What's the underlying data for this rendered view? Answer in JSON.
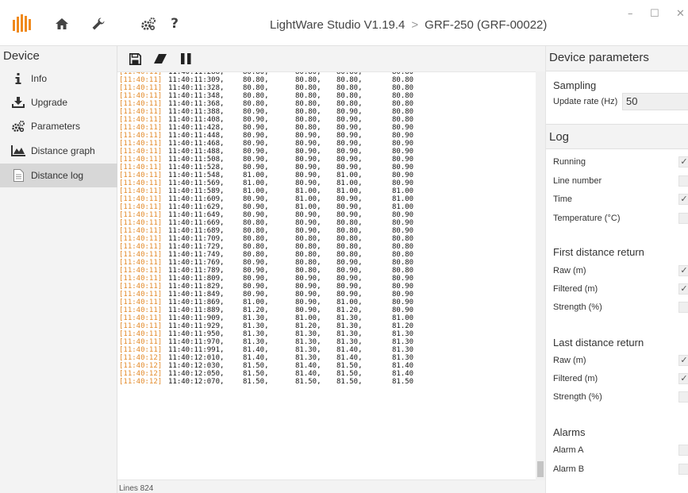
{
  "app": {
    "title": "LightWare Studio V1.19.4",
    "separator": ">",
    "device": "GRF-250 (GRF-00022)",
    "brand_color": "#f08a1d",
    "icons": [
      "home-icon",
      "wrench-icon",
      "gears-icon",
      "help-icon"
    ],
    "help_label": "?",
    "window_controls": {
      "minimize": "–",
      "maximize": "☐",
      "close": "✕"
    }
  },
  "sidebar": {
    "title": "Device",
    "items": [
      {
        "label": "Info",
        "icon": "info-icon"
      },
      {
        "label": "Upgrade",
        "icon": "download-icon"
      },
      {
        "label": "Parameters",
        "icon": "gears-icon"
      },
      {
        "label": "Distance graph",
        "icon": "area-chart-icon"
      },
      {
        "label": "Distance log",
        "icon": "document-icon",
        "active": true
      }
    ]
  },
  "log": {
    "toolbar": [
      "save-icon",
      "eraser-icon",
      "pause-icon"
    ],
    "lines_label": "Lines 824",
    "rows": [
      [
        "[11:40:11]",
        "11:40:11:288,",
        "80.80,",
        "80.80,",
        "80.80,",
        "80.80"
      ],
      [
        "[11:40:11]",
        "11:40:11:309,",
        "80.80,",
        "80.80,",
        "80.80,",
        "80.80"
      ],
      [
        "[11:40:11]",
        "11:40:11:328,",
        "80.80,",
        "80.80,",
        "80.80,",
        "80.80"
      ],
      [
        "[11:40:11]",
        "11:40:11:348,",
        "80.80,",
        "80.80,",
        "80.80,",
        "80.80"
      ],
      [
        "[11:40:11]",
        "11:40:11:368,",
        "80.80,",
        "80.80,",
        "80.80,",
        "80.80"
      ],
      [
        "[11:40:11]",
        "11:40:11:388,",
        "80.90,",
        "80.80,",
        "80.90,",
        "80.80"
      ],
      [
        "[11:40:11]",
        "11:40:11:408,",
        "80.90,",
        "80.80,",
        "80.90,",
        "80.80"
      ],
      [
        "[11:40:11]",
        "11:40:11:428,",
        "80.90,",
        "80.80,",
        "80.90,",
        "80.90"
      ],
      [
        "[11:40:11]",
        "11:40:11:448,",
        "80.90,",
        "80.90,",
        "80.90,",
        "80.90"
      ],
      [
        "[11:40:11]",
        "11:40:11:468,",
        "80.90,",
        "80.90,",
        "80.90,",
        "80.90"
      ],
      [
        "[11:40:11]",
        "11:40:11:488,",
        "80.90,",
        "80.90,",
        "80.90,",
        "80.90"
      ],
      [
        "[11:40:11]",
        "11:40:11:508,",
        "80.90,",
        "80.90,",
        "80.90,",
        "80.90"
      ],
      [
        "[11:40:11]",
        "11:40:11:528,",
        "80.90,",
        "80.90,",
        "80.90,",
        "80.90"
      ],
      [
        "[11:40:11]",
        "11:40:11:548,",
        "81.00,",
        "80.90,",
        "81.00,",
        "80.90"
      ],
      [
        "[11:40:11]",
        "11:40:11:569,",
        "81.00,",
        "80.90,",
        "81.00,",
        "80.90"
      ],
      [
        "[11:40:11]",
        "11:40:11:589,",
        "81.00,",
        "81.00,",
        "81.00,",
        "81.00"
      ],
      [
        "[11:40:11]",
        "11:40:11:609,",
        "80.90,",
        "81.00,",
        "80.90,",
        "81.00"
      ],
      [
        "[11:40:11]",
        "11:40:11:629,",
        "80.90,",
        "81.00,",
        "80.90,",
        "81.00"
      ],
      [
        "[11:40:11]",
        "11:40:11:649,",
        "80.90,",
        "80.90,",
        "80.90,",
        "80.90"
      ],
      [
        "[11:40:11]",
        "11:40:11:669,",
        "80.80,",
        "80.90,",
        "80.80,",
        "80.90"
      ],
      [
        "[11:40:11]",
        "11:40:11:689,",
        "80.80,",
        "80.90,",
        "80.80,",
        "80.90"
      ],
      [
        "[11:40:11]",
        "11:40:11:709,",
        "80.80,",
        "80.80,",
        "80.80,",
        "80.80"
      ],
      [
        "[11:40:11]",
        "11:40:11:729,",
        "80.80,",
        "80.80,",
        "80.80,",
        "80.80"
      ],
      [
        "[11:40:11]",
        "11:40:11:749,",
        "80.80,",
        "80.80,",
        "80.80,",
        "80.80"
      ],
      [
        "[11:40:11]",
        "11:40:11:769,",
        "80.90,",
        "80.80,",
        "80.90,",
        "80.80"
      ],
      [
        "[11:40:11]",
        "11:40:11:789,",
        "80.90,",
        "80.80,",
        "80.90,",
        "80.80"
      ],
      [
        "[11:40:11]",
        "11:40:11:809,",
        "80.90,",
        "80.90,",
        "80.90,",
        "80.90"
      ],
      [
        "[11:40:11]",
        "11:40:11:829,",
        "80.90,",
        "80.90,",
        "80.90,",
        "80.90"
      ],
      [
        "[11:40:11]",
        "11:40:11:849,",
        "80.90,",
        "80.90,",
        "80.90,",
        "80.90"
      ],
      [
        "[11:40:11]",
        "11:40:11:869,",
        "81.00,",
        "80.90,",
        "81.00,",
        "80.90"
      ],
      [
        "[11:40:11]",
        "11:40:11:889,",
        "81.20,",
        "80.90,",
        "81.20,",
        "80.90"
      ],
      [
        "[11:40:11]",
        "11:40:11:909,",
        "81.30,",
        "81.00,",
        "81.30,",
        "81.00"
      ],
      [
        "[11:40:11]",
        "11:40:11:929,",
        "81.30,",
        "81.20,",
        "81.30,",
        "81.20"
      ],
      [
        "[11:40:11]",
        "11:40:11:950,",
        "81.30,",
        "81.30,",
        "81.30,",
        "81.30"
      ],
      [
        "[11:40:11]",
        "11:40:11:970,",
        "81.30,",
        "81.30,",
        "81.30,",
        "81.30"
      ],
      [
        "[11:40:11]",
        "11:40:11:991,",
        "81.40,",
        "81.30,",
        "81.40,",
        "81.30"
      ],
      [
        "[11:40:12]",
        "11:40:12:010,",
        "81.40,",
        "81.30,",
        "81.40,",
        "81.30"
      ],
      [
        "[11:40:12]",
        "11:40:12:030,",
        "81.50,",
        "81.40,",
        "81.50,",
        "81.40"
      ],
      [
        "[11:40:12]",
        "11:40:12:050,",
        "81.50,",
        "81.40,",
        "81.50,",
        "81.40"
      ],
      [
        "[11:40:12]",
        "11:40:12:070,",
        "81.50,",
        "81.50,",
        "81.50,",
        "81.50"
      ]
    ]
  },
  "params": {
    "header": "Device parameters",
    "sampling_title": "Sampling",
    "update_rate_label": "Update rate (Hz)",
    "update_rate_value": "50",
    "log_title": "Log",
    "log_options": [
      {
        "label": "Running",
        "checked": true
      },
      {
        "label": "Line number",
        "checked": false
      },
      {
        "label": "Time",
        "checked": true
      },
      {
        "label": "Temperature (°C)",
        "checked": false
      }
    ],
    "first_return_title": "First distance return",
    "first_return": [
      {
        "label": "Raw (m)",
        "checked": true
      },
      {
        "label": "Filtered (m)",
        "checked": true
      },
      {
        "label": "Strength (%)",
        "checked": false
      }
    ],
    "last_return_title": "Last distance return",
    "last_return": [
      {
        "label": "Raw (m)",
        "checked": true
      },
      {
        "label": "Filtered (m)",
        "checked": true
      },
      {
        "label": "Strength (%)",
        "checked": false
      }
    ],
    "alarms_title": "Alarms",
    "alarms": [
      {
        "label": "Alarm A",
        "checked": false
      },
      {
        "label": "Alarm B",
        "checked": false
      }
    ],
    "check_glyph": "✓"
  }
}
